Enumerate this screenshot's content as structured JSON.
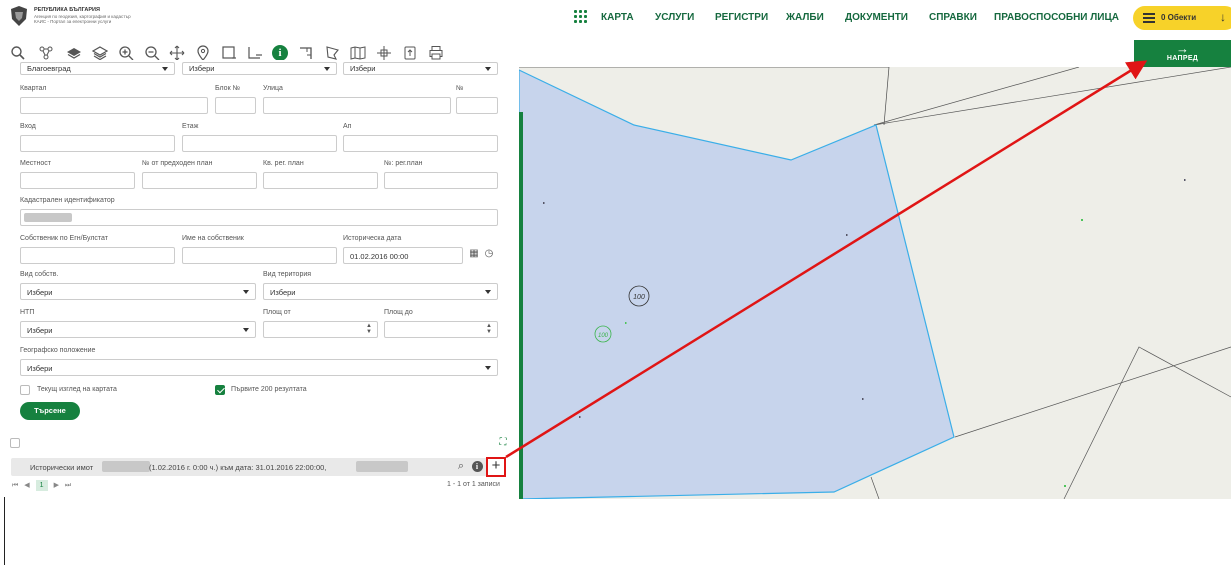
{
  "header": {
    "logo_line1": "РЕПУБЛИКА БЪЛГАРИЯ",
    "logo_line2": "Агенция по геодезия, картография и кадастър",
    "logo_line3": "КАИС - Портал за електронни услуги",
    "nav": [
      "КАРТА",
      "УСЛУГИ",
      "РЕГИСТРИ",
      "ЖАЛБИ",
      "ДОКУМЕНТИ",
      "СПРАВКИ",
      "ПРАВОСПОСОБНИ ЛИЦА"
    ],
    "objects_label": "0 Обекти"
  },
  "forward": {
    "arrow": "→",
    "label": "НАПРЕД"
  },
  "form": {
    "region_value": "Благоевград",
    "municipality_value": "Избери",
    "settlement_value": "Избери",
    "labels": {
      "quarter": "Квартал",
      "block": "Блок №",
      "street": "Улица",
      "number": "№",
      "entrance": "Вход",
      "floor": "Етаж",
      "apartment": "Ап",
      "locality": "Местност",
      "prev_plan_no": "№ от предходен план",
      "kv_plan": "Кв. рег. план",
      "reg_plan_no": "№: рег.план",
      "cadastral_id": "Кадастрален идентификатор",
      "owner_id": "Собственик по Егн/Булстат",
      "owner_name": "Име на собственик",
      "historical_date": "Историческа дата",
      "ownership_type": "Вид собств.",
      "territory_type": "Вид територия",
      "ntp": "НТП",
      "area_from": "Площ от",
      "area_to": "Площ до",
      "geo_position": "Географско положение"
    },
    "historical_date_value": "01.02.2016 00:00",
    "ownership_value": "Избери",
    "territory_value": "Избери",
    "ntp_value": "Избери",
    "geo_value": "Избери",
    "checkbox_current_view": "Текущ изглед на картата",
    "checkbox_first200": "Първите 200 резултата",
    "search_button": "Търсене"
  },
  "results": {
    "prefix": "Исторически имот",
    "middle": "(1.02.2016 г. 0:00 ч.) към дата: 31.01.2016 22:00:00,",
    "plus": "+",
    "pager_first": "⏮",
    "pager_prev": "◀",
    "page": "1",
    "pager_next": "▶",
    "pager_last": "⏭",
    "count": "1 - 1 от 1 записи"
  },
  "map": {
    "label_1": "100",
    "label_2": "100"
  },
  "colors": {
    "brand_green": "#16813f",
    "accent_yellow": "#f7d229",
    "annotation_red": "#e01515",
    "parcel_fill": "#c7d4ec",
    "parcel_stroke": "#3aaee8"
  }
}
